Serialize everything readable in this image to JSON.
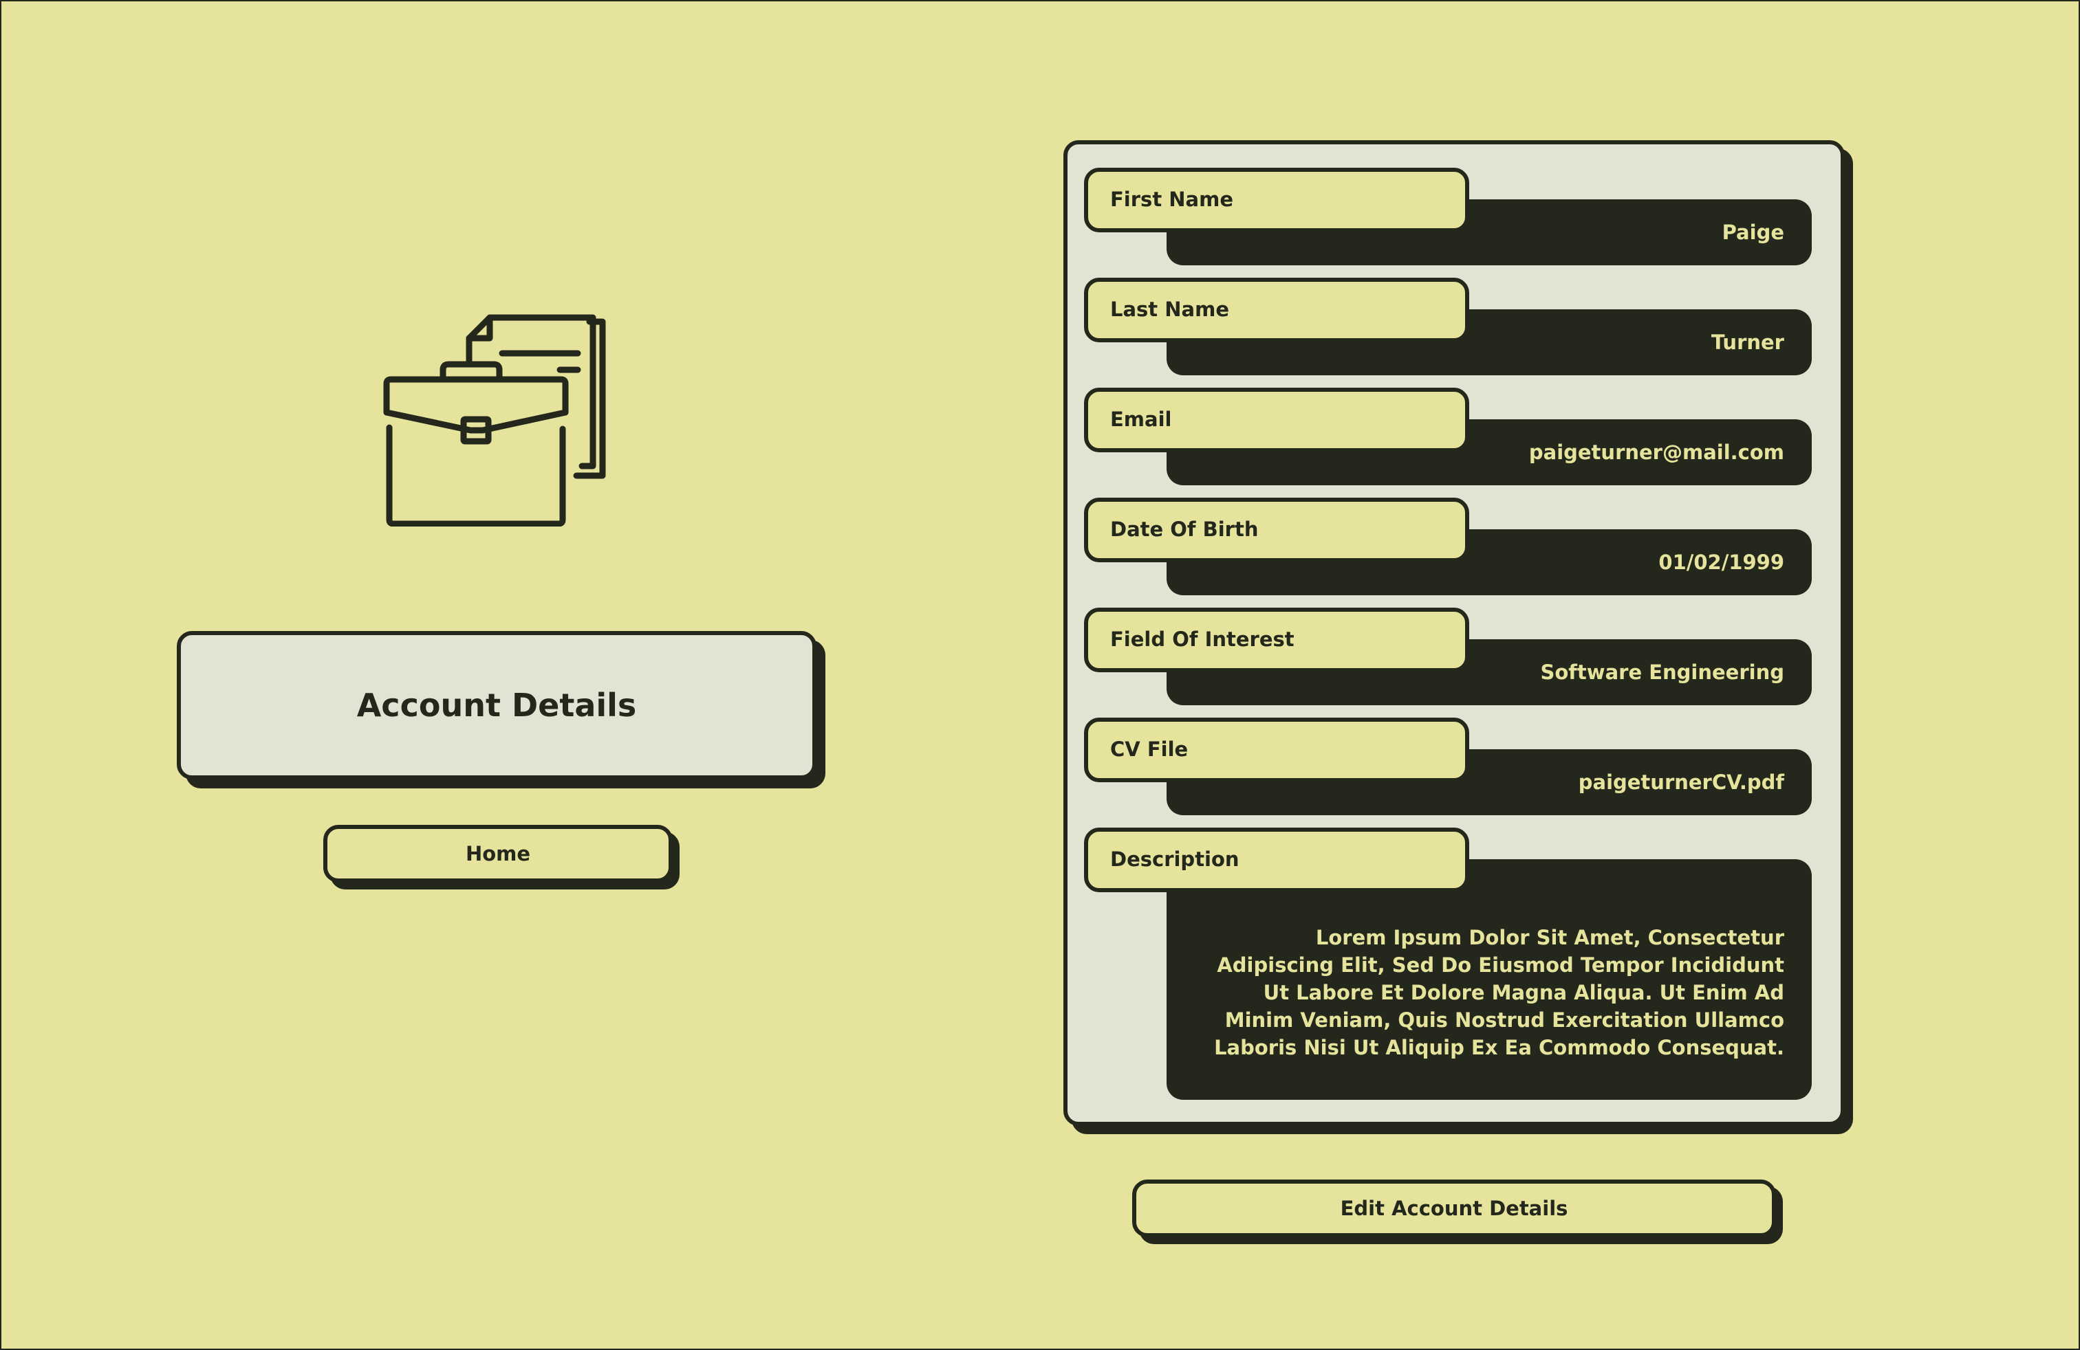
{
  "page": {
    "title": "Account Details",
    "home_label": "Home",
    "edit_label": "Edit Account Details",
    "hero_icon": "briefcase-documents-icon"
  },
  "fields": [
    {
      "label": "First Name",
      "value": "Paige"
    },
    {
      "label": "Last Name",
      "value": "Turner"
    },
    {
      "label": "Email",
      "value": "paigeturner@mail.com"
    },
    {
      "label": "Date Of Birth",
      "value": "01/02/1999"
    },
    {
      "label": "Field Of Interest",
      "value": "Software Engineering"
    },
    {
      "label": "CV File",
      "value": "paigeturnerCV.pdf"
    },
    {
      "label": "Description",
      "value": "Lorem Ipsum Dolor Sit Amet, Consectetur Adipiscing Elit, Sed Do Eiusmod Tempor Incididunt Ut Labore Et Dolore Magna Aliqua. Ut Enim Ad Minim Veniam, Quis Nostrud Exercitation Ullamco Laboris Nisi Ut Aliquip Ex Ea Commodo Consequat."
    }
  ],
  "colors": {
    "background": "#e6e39c",
    "card": "#e2e3d2",
    "dark": "#23271c",
    "value_text": "#e6e39c"
  }
}
